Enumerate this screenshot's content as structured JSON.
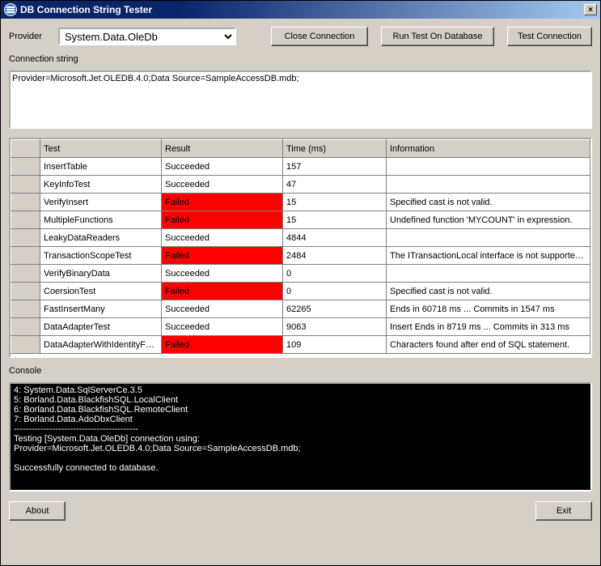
{
  "title": "DB Connection String Tester",
  "labels": {
    "provider": "Provider",
    "connectionString": "Connection string",
    "console": "Console"
  },
  "buttons": {
    "closeConnection": "Close Connection",
    "runTest": "Run Test On Database",
    "testConnection": "Test Connection",
    "about": "About",
    "exit": "Exit",
    "windowClose": "×"
  },
  "provider": {
    "selected": "System.Data.OleDb",
    "options": [
      "System.Data.OleDb"
    ]
  },
  "connectionString": "Provider=Microsoft.Jet.OLEDB.4.0;Data Source=SampleAccessDB.mdb;",
  "grid": {
    "headers": {
      "test": "Test",
      "result": "Result",
      "time": "Time (ms)",
      "info": "Information"
    },
    "rows": [
      {
        "test": "InsertTable",
        "result": "Succeeded",
        "failed": false,
        "time": "157",
        "info": ""
      },
      {
        "test": "KeyInfoTest",
        "result": "Succeeded",
        "failed": false,
        "time": "47",
        "info": ""
      },
      {
        "test": "VerifyInsert",
        "result": "Failed",
        "failed": true,
        "time": "15",
        "info": "Specified cast is not valid."
      },
      {
        "test": "MultipleFunctions",
        "result": "Failed",
        "failed": true,
        "time": "15",
        "info": "Undefined function 'MYCOUNT' in expression."
      },
      {
        "test": "LeakyDataReaders",
        "result": "Succeeded",
        "failed": false,
        "time": "4844",
        "info": ""
      },
      {
        "test": "TransactionScopeTest",
        "result": "Failed",
        "failed": true,
        "time": "2484",
        "info": "The ITransactionLocal interface is not supported..."
      },
      {
        "test": "VerifyBinaryData",
        "result": "Succeeded",
        "failed": false,
        "time": "0",
        "info": ""
      },
      {
        "test": "CoersionTest",
        "result": "Failed",
        "failed": true,
        "time": "0",
        "info": "Specified cast is not valid."
      },
      {
        "test": "FastInsertMany",
        "result": "Succeeded",
        "failed": false,
        "time": "62265",
        "info": "Ends in 60718 ms ... Commits in 1547 ms"
      },
      {
        "test": "DataAdapterTest",
        "result": "Succeeded",
        "failed": false,
        "time": "9063",
        "info": "Insert Ends in 8719 ms ... Commits in 313 ms"
      },
      {
        "test": "DataAdapterWithIdentityFet...",
        "result": "Failed",
        "failed": true,
        "time": "109",
        "info": "Characters found after end of SQL statement."
      }
    ]
  },
  "console": "4: System.Data.SqlServerCe.3.5\n5: Borland.Data.BlackfishSQL.LocalClient\n6: Borland.Data.BlackfishSQL.RemoteClient\n7: Borland.Data.AdoDbxClient\n------------------------------------------\nTesting [System.Data.OleDb] connection using:\nProvider=Microsoft.Jet.OLEDB.4.0;Data Source=SampleAccessDB.mdb;\n\nSuccessfully connected to database."
}
